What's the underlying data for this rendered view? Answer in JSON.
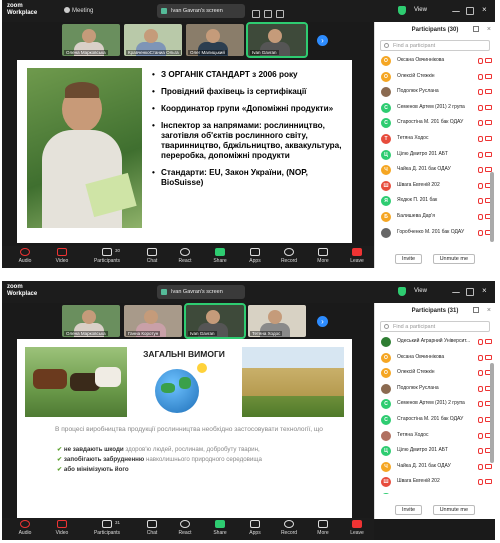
{
  "screen1": {
    "app": {
      "logo_line1": "zoom",
      "logo_line2": "Workplace",
      "meeting": "Meeting",
      "screen_label": "Ivan Gavran's screen",
      "view_label": "View"
    },
    "thumbs": [
      {
        "name": "Олена Марковська"
      },
      {
        "name": "КравченкоСтаниа Ольга"
      },
      {
        "name": "Олег Малицький"
      },
      {
        "name": "Ivan Gavran"
      }
    ],
    "slide": {
      "bullets": [
        "З ОРГАНІК СТАНДАРТ з 2006 року",
        "Провідний фахівець із сертифікації",
        "Координатор групи «Допоміжні продукти»",
        "Інспектор за напрямами: рослинництво, заготівля об'єктів рослинного світу, тваринництво, бджільництво, аквакультура, переробка, допоміжні продукти",
        "Стандарти: ЕU, Закон України, (NOP, BioSuisse)"
      ]
    },
    "panel": {
      "title": "Participants (30)",
      "search_placeholder": "Find a participant",
      "invite": "Invite",
      "unmute": "Unmute me",
      "participants": [
        {
          "name": "Оксана Овчиннікова",
          "initial": "О",
          "color": "#f5a623"
        },
        {
          "name": "Олексій Стежкін",
          "initial": "О",
          "color": "#f5a623"
        },
        {
          "name": "Подолюк Руслана",
          "initial": "",
          "color": "#8b6a50"
        },
        {
          "name": "Семенов Артем (201) 2 група",
          "initial": "С",
          "color": "#2ecc71"
        },
        {
          "name": "Старостіна М. 201 бак ОДАУ",
          "initial": "С",
          "color": "#2ecc71"
        },
        {
          "name": "Тетяна Ходос",
          "initial": "Т",
          "color": "#e74c3c"
        },
        {
          "name": "Цілю Дмитро 201 АБТ",
          "initial": "Ц",
          "color": "#2ecc71"
        },
        {
          "name": "Чайка Д. 201 бак ОДАУ",
          "initial": "Ч",
          "color": "#f5a623"
        },
        {
          "name": "Швага Евгеній 202",
          "initial": "Ш",
          "color": "#e74c3c"
        },
        {
          "name": "Яхдюк П. 201 бак",
          "initial": "Я",
          "color": "#2ecc71"
        },
        {
          "name": "Балишева Дар'я",
          "initial": "Б",
          "color": "#f5a623"
        },
        {
          "name": "Горобченко М. 201 бак ОДАУ",
          "initial": "",
          "color": "#666"
        }
      ]
    },
    "toolbar": [
      {
        "label": "Audio"
      },
      {
        "label": "Video"
      },
      {
        "label": "Participants",
        "count": "30"
      },
      {
        "label": "Chat"
      },
      {
        "label": "React"
      },
      {
        "label": "Share"
      },
      {
        "label": "Apps"
      },
      {
        "label": "Record"
      },
      {
        "label": "More"
      },
      {
        "label": "Leave"
      }
    ]
  },
  "screen2": {
    "app": {
      "logo_line1": "zoom",
      "logo_line2": "Workplace",
      "screen_label": "Ivan Gavran's screen",
      "view_label": "View"
    },
    "thumbs": [
      {
        "name": "Олена Марковська"
      },
      {
        "name": "Ганна Коротун"
      },
      {
        "name": "Ivan Gavran"
      },
      {
        "name": "Тетяна Ходос"
      }
    ],
    "slide": {
      "title": "ЗАГАЛЬНІ ВИМОГИ",
      "intro": "В процесі виробництва продукції рослинництва необхідно застосовувати технології, що",
      "checks": [
        {
          "bold": "не завдають шкоди",
          "rest": " здоров'ю людей, рослинам, добробуту тварин,"
        },
        {
          "bold": "запобігають забрудненню",
          "rest": " навколишнього природного середовища"
        },
        {
          "bold": "або мінімізують його",
          "rest": ""
        }
      ]
    },
    "panel": {
      "title": "Participants (31)",
      "search_placeholder": "Find a participant",
      "invite": "Invite",
      "unmute": "Unmute me",
      "participants": [
        {
          "name": "Одеський Аграрний Університ...",
          "initial": "",
          "color": "#2e7d32"
        },
        {
          "name": "Оксана Овчиннікова",
          "initial": "О",
          "color": "#f5a623"
        },
        {
          "name": "Олексій Стежкін",
          "initial": "О",
          "color": "#f5a623"
        },
        {
          "name": "Подолюк Руслана",
          "initial": "",
          "color": "#8b6a50"
        },
        {
          "name": "Семенов Артем (201) 2 група",
          "initial": "С",
          "color": "#2ecc71"
        },
        {
          "name": "Старостіна М. 201 бак ОДАУ",
          "initial": "С",
          "color": "#2ecc71"
        },
        {
          "name": "Тетяна Ходос",
          "initial": "",
          "color": "#b07060"
        },
        {
          "name": "Цілю Дмитро 201 АБТ",
          "initial": "Ц",
          "color": "#2ecc71"
        },
        {
          "name": "Чайка Д. 201 бак ОДАУ",
          "initial": "Ч",
          "color": "#f5a623"
        },
        {
          "name": "Швага Евгеній 202",
          "initial": "Ш",
          "color": "#e74c3c"
        },
        {
          "name": "Яхдюк П. 201 бак",
          "initial": "Я",
          "color": "#2ecc71"
        },
        {
          "name": "Балишева Дар'я",
          "initial": "Б",
          "color": "#f5a623"
        }
      ]
    },
    "toolbar": [
      {
        "label": "Audio"
      },
      {
        "label": "Video"
      },
      {
        "label": "Participants",
        "count": "31"
      },
      {
        "label": "Chat"
      },
      {
        "label": "React"
      },
      {
        "label": "Share"
      },
      {
        "label": "Apps"
      },
      {
        "label": "Record"
      },
      {
        "label": "More"
      },
      {
        "label": "Leave"
      }
    ]
  }
}
